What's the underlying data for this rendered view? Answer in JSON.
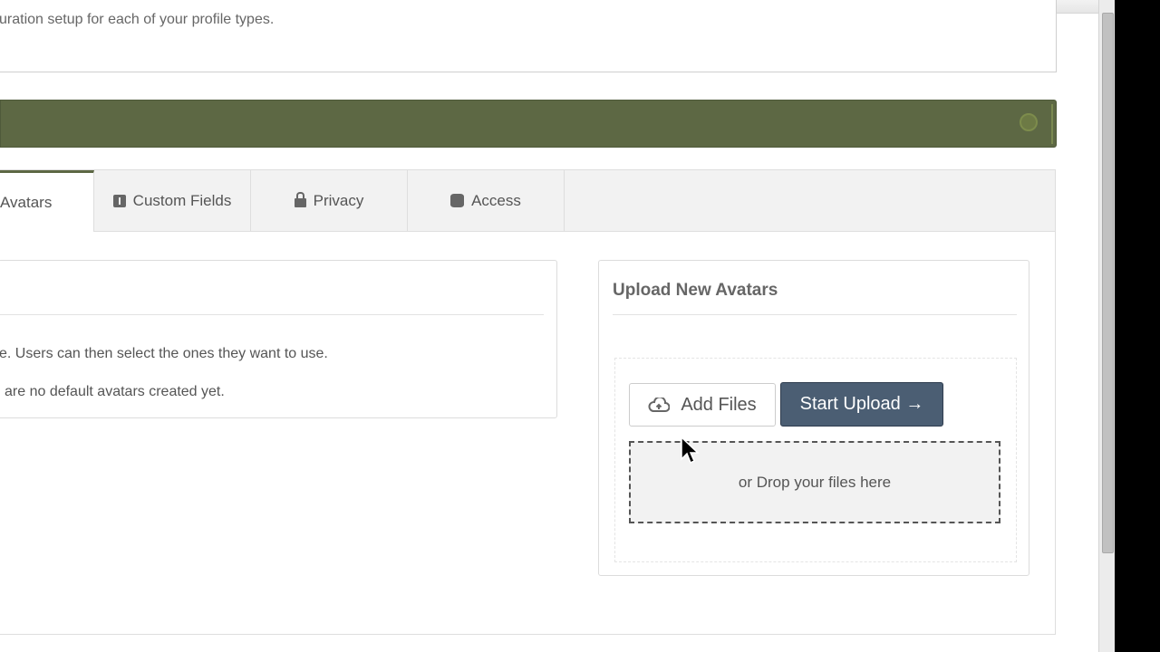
{
  "description": {
    "text": "uration setup for each of your profile types."
  },
  "tabs": [
    {
      "label": "Avatars",
      "icon": "avatars-icon",
      "active": true
    },
    {
      "label": "Custom Fields",
      "icon": "info-icon",
      "active": false
    },
    {
      "label": "Privacy",
      "icon": "lock-icon",
      "active": false
    },
    {
      "label": "Access",
      "icon": "database-icon",
      "active": false
    }
  ],
  "left_card": {
    "line1": "e. Users can then select the ones they want to use.",
    "line2": "are no default avatars created yet."
  },
  "upload": {
    "title": "Upload New Avatars",
    "add_files_label": "Add Files",
    "start_upload_label": "Start Upload →",
    "drop_text": "or Drop your files here"
  },
  "colors": {
    "header_bar": "#5d6844",
    "start_upload_button": "#4b5e73"
  }
}
